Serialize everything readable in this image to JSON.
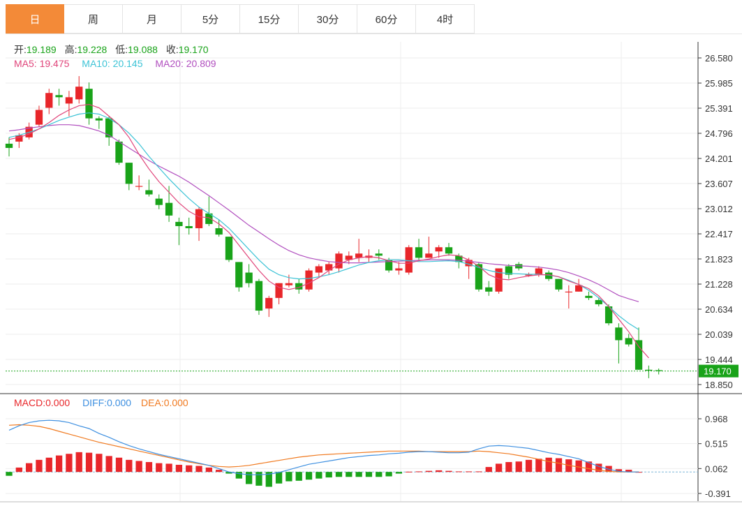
{
  "tabs": [
    {
      "label": "日",
      "active": true
    },
    {
      "label": "周",
      "active": false
    },
    {
      "label": "月",
      "active": false
    },
    {
      "label": "5分",
      "active": false
    },
    {
      "label": "15分",
      "active": false
    },
    {
      "label": "30分",
      "active": false
    },
    {
      "label": "60分",
      "active": false
    },
    {
      "label": "4时",
      "active": false
    }
  ],
  "ohlc_legend": {
    "open_label": "开:",
    "open": "19.189",
    "high_label": "高:",
    "high": "19.228",
    "low_label": "低:",
    "low": "19.088",
    "close_label": "收:",
    "close": "19.170"
  },
  "ma_legend": {
    "ma5_label": "MA5: ",
    "ma5": "19.475",
    "ma10_label": "MA10: ",
    "ma10": "20.145",
    "ma20_label": "MA20: ",
    "ma20": "20.809"
  },
  "macd_legend": {
    "macd_label": "MACD:",
    "macd": "0.000",
    "diff_label": "DIFF:",
    "diff": "0.000",
    "dea_label": "DEA:",
    "dea": "0.000"
  },
  "colors": {
    "up": "#e8262a",
    "down": "#19a319",
    "ma5": "#e0447a",
    "ma10": "#3cc3d6",
    "ma20": "#b14fbf",
    "diff": "#3d8fe0",
    "dea": "#f07a20",
    "active_tab": "#f38a38",
    "last_price": "#19a319"
  },
  "chart_data": [
    {
      "type": "candlestick",
      "y_ticks": [
        "26.580",
        "25.985",
        "25.391",
        "24.796",
        "24.201",
        "23.607",
        "23.012",
        "22.417",
        "21.823",
        "21.228",
        "20.634",
        "20.039",
        "19.444",
        "18.850"
      ],
      "ylim": [
        18.85,
        26.58
      ],
      "last_price": "19.170",
      "candles": [
        [
          24.55,
          24.7,
          24.25,
          24.45
        ],
        [
          24.6,
          24.8,
          24.45,
          24.75
        ],
        [
          24.7,
          25.05,
          24.65,
          24.95
        ],
        [
          25.0,
          25.45,
          24.95,
          25.35
        ],
        [
          25.4,
          25.85,
          25.25,
          25.75
        ],
        [
          25.7,
          25.85,
          25.45,
          25.65
        ],
        [
          25.5,
          25.8,
          25.2,
          25.65
        ],
        [
          25.6,
          26.15,
          25.5,
          25.9
        ],
        [
          25.85,
          26.0,
          25.0,
          25.15
        ],
        [
          25.15,
          25.2,
          24.9,
          25.1
        ],
        [
          25.15,
          25.2,
          24.5,
          24.7
        ],
        [
          24.6,
          24.65,
          24.05,
          24.1
        ],
        [
          24.1,
          24.1,
          23.45,
          23.6
        ],
        [
          23.55,
          23.8,
          23.45,
          23.55
        ],
        [
          23.45,
          23.7,
          23.3,
          23.35
        ],
        [
          23.25,
          23.35,
          23.0,
          23.1
        ],
        [
          23.15,
          23.55,
          22.7,
          22.85
        ],
        [
          22.7,
          22.8,
          22.15,
          22.6
        ],
        [
          22.6,
          22.8,
          22.4,
          22.55
        ],
        [
          22.55,
          23.05,
          22.25,
          23.0
        ],
        [
          22.9,
          23.3,
          22.6,
          22.65
        ],
        [
          22.55,
          22.75,
          22.35,
          22.4
        ],
        [
          22.35,
          22.35,
          21.75,
          21.8
        ],
        [
          21.75,
          21.75,
          21.05,
          21.15
        ],
        [
          21.5,
          21.7,
          21.15,
          21.25
        ],
        [
          21.3,
          21.35,
          20.5,
          20.6
        ],
        [
          20.65,
          20.95,
          20.45,
          20.9
        ],
        [
          20.9,
          21.25,
          20.75,
          21.25
        ],
        [
          21.2,
          21.45,
          21.15,
          21.25
        ],
        [
          21.25,
          21.35,
          21.0,
          21.1
        ],
        [
          21.1,
          21.6,
          21.05,
          21.55
        ],
        [
          21.5,
          21.7,
          21.4,
          21.65
        ],
        [
          21.55,
          21.75,
          21.45,
          21.7
        ],
        [
          21.6,
          22.0,
          21.5,
          21.95
        ],
        [
          21.8,
          22.0,
          21.7,
          21.9
        ],
        [
          21.85,
          22.3,
          21.75,
          21.95
        ],
        [
          21.85,
          22.05,
          21.75,
          21.9
        ],
        [
          21.95,
          22.05,
          21.8,
          21.9
        ],
        [
          21.8,
          21.85,
          21.5,
          21.55
        ],
        [
          21.55,
          21.75,
          21.45,
          21.6
        ],
        [
          21.5,
          22.15,
          21.45,
          22.1
        ],
        [
          22.1,
          22.3,
          21.8,
          21.85
        ],
        [
          21.85,
          22.35,
          21.85,
          21.95
        ],
        [
          22.0,
          22.15,
          21.85,
          22.1
        ],
        [
          22.1,
          22.2,
          21.9,
          21.95
        ],
        [
          21.9,
          21.95,
          21.6,
          21.75
        ],
        [
          21.65,
          21.85,
          21.35,
          21.8
        ],
        [
          21.7,
          21.75,
          21.05,
          21.1
        ],
        [
          21.15,
          21.3,
          20.95,
          21.05
        ],
        [
          21.05,
          21.6,
          21.0,
          21.6
        ],
        [
          21.65,
          21.7,
          21.35,
          21.45
        ],
        [
          21.7,
          21.75,
          21.55,
          21.6
        ],
        [
          21.45,
          21.5,
          21.4,
          21.45
        ],
        [
          21.45,
          21.65,
          21.4,
          21.6
        ],
        [
          21.5,
          21.55,
          21.3,
          21.35
        ],
        [
          21.35,
          21.35,
          21.05,
          21.1
        ],
        [
          21.05,
          21.2,
          20.65,
          21.05
        ],
        [
          21.05,
          21.35,
          21.05,
          21.2
        ],
        [
          20.95,
          21.05,
          20.85,
          20.9
        ],
        [
          20.85,
          20.9,
          20.7,
          20.75
        ],
        [
          20.7,
          20.75,
          20.25,
          20.3
        ],
        [
          20.2,
          20.3,
          19.35,
          19.9
        ],
        [
          19.95,
          20.05,
          19.75,
          19.8
        ],
        [
          19.9,
          20.2,
          19.2,
          19.2
        ],
        [
          19.2,
          19.3,
          19.0,
          19.18
        ],
        [
          19.19,
          19.23,
          19.09,
          19.17
        ]
      ],
      "ma5": [
        24.65,
        24.7,
        24.78,
        24.9,
        25.05,
        25.22,
        25.35,
        25.45,
        25.48,
        25.4,
        25.2,
        25.0,
        24.7,
        24.3,
        23.95,
        23.65,
        23.4,
        23.15,
        22.95,
        22.82,
        22.8,
        22.65,
        22.45,
        22.15,
        21.85,
        21.55,
        21.3,
        21.15,
        21.1,
        21.15,
        21.25,
        21.38,
        21.55,
        21.7,
        21.8,
        21.85,
        21.88,
        21.85,
        21.78,
        21.72,
        21.72,
        21.78,
        21.82,
        21.88,
        21.92,
        21.9,
        21.8,
        21.65,
        21.45,
        21.35,
        21.33,
        21.38,
        21.42,
        21.45,
        21.45,
        21.4,
        21.3,
        21.22,
        21.12,
        20.95,
        20.7,
        20.4,
        20.1,
        19.75,
        19.48
      ],
      "ma10": [
        24.7,
        24.75,
        24.82,
        24.9,
        25.0,
        25.1,
        25.18,
        25.25,
        25.28,
        25.25,
        25.15,
        25.0,
        24.8,
        24.55,
        24.25,
        23.98,
        23.72,
        23.48,
        23.25,
        23.05,
        22.9,
        22.75,
        22.55,
        22.3,
        22.05,
        21.8,
        21.58,
        21.45,
        21.38,
        21.35,
        21.36,
        21.4,
        21.45,
        21.52,
        21.6,
        21.68,
        21.74,
        21.78,
        21.8,
        21.8,
        21.78,
        21.76,
        21.76,
        21.77,
        21.78,
        21.76,
        21.7,
        21.62,
        21.55,
        21.5,
        21.48,
        21.47,
        21.46,
        21.46,
        21.44,
        21.4,
        21.32,
        21.22,
        21.08,
        20.9,
        20.7,
        20.48,
        20.3,
        20.15
      ],
      "ma20": [
        24.85,
        24.88,
        24.92,
        24.95,
        24.98,
        25.0,
        25.0,
        24.98,
        24.92,
        24.85,
        24.75,
        24.6,
        24.45,
        24.3,
        24.15,
        24.02,
        23.9,
        23.78,
        23.64,
        23.48,
        23.32,
        23.15,
        22.98,
        22.8,
        22.62,
        22.46,
        22.3,
        22.15,
        22.02,
        21.92,
        21.85,
        21.8,
        21.76,
        21.74,
        21.73,
        21.73,
        21.74,
        21.75,
        21.76,
        21.77,
        21.78,
        21.79,
        21.8,
        21.8,
        21.8,
        21.79,
        21.77,
        21.74,
        21.71,
        21.69,
        21.67,
        21.66,
        21.65,
        21.63,
        21.6,
        21.56,
        21.5,
        21.42,
        21.33,
        21.22,
        21.09,
        20.96,
        20.88,
        20.81
      ],
      "ma_start_index": [
        0,
        0,
        0
      ]
    },
    {
      "type": "macd",
      "y_ticks": [
        "0.968",
        "0.515",
        "0.062",
        "-0.391"
      ],
      "ylim": [
        -0.391,
        0.968
      ],
      "hist": [
        -0.07,
        0.08,
        0.16,
        0.22,
        0.26,
        0.3,
        0.33,
        0.36,
        0.35,
        0.33,
        0.29,
        0.26,
        0.22,
        0.2,
        0.18,
        0.16,
        0.15,
        0.13,
        0.12,
        0.11,
        0.08,
        0.04,
        -0.03,
        -0.12,
        -0.22,
        -0.25,
        -0.27,
        -0.21,
        -0.17,
        -0.16,
        -0.14,
        -0.12,
        -0.1,
        -0.09,
        -0.09,
        -0.09,
        -0.09,
        -0.09,
        -0.08,
        -0.03,
        0.005,
        0.01,
        0.02,
        0.03,
        0.02,
        0.01,
        0.01,
        0.01,
        0.09,
        0.15,
        0.18,
        0.19,
        0.22,
        0.24,
        0.26,
        0.25,
        0.23,
        0.21,
        0.19,
        0.15,
        0.11,
        0.05,
        0.04,
        0.0
      ],
      "diff": [
        0.76,
        0.84,
        0.9,
        0.93,
        0.94,
        0.93,
        0.9,
        0.84,
        0.79,
        0.7,
        0.63,
        0.55,
        0.48,
        0.42,
        0.37,
        0.32,
        0.28,
        0.24,
        0.2,
        0.16,
        0.12,
        0.06,
        0.0,
        -0.03,
        -0.05,
        -0.05,
        -0.04,
        -0.01,
        0.04,
        0.09,
        0.14,
        0.17,
        0.2,
        0.23,
        0.26,
        0.28,
        0.3,
        0.31,
        0.33,
        0.34,
        0.36,
        0.37,
        0.37,
        0.36,
        0.35,
        0.35,
        0.36,
        0.42,
        0.47,
        0.48,
        0.47,
        0.45,
        0.43,
        0.39,
        0.35,
        0.32,
        0.28,
        0.24,
        0.17,
        0.1,
        0.05,
        0.01,
        0.0,
        0.0
      ],
      "dea": [
        0.85,
        0.86,
        0.85,
        0.83,
        0.79,
        0.74,
        0.69,
        0.64,
        0.59,
        0.54,
        0.5,
        0.46,
        0.42,
        0.38,
        0.34,
        0.3,
        0.26,
        0.22,
        0.18,
        0.15,
        0.12,
        0.1,
        0.09,
        0.1,
        0.12,
        0.15,
        0.18,
        0.21,
        0.24,
        0.27,
        0.29,
        0.31,
        0.32,
        0.33,
        0.34,
        0.35,
        0.36,
        0.37,
        0.38,
        0.38,
        0.38,
        0.38,
        0.37,
        0.37,
        0.37,
        0.37,
        0.37,
        0.38,
        0.37,
        0.35,
        0.33,
        0.3,
        0.27,
        0.23,
        0.19,
        0.16,
        0.12,
        0.09,
        0.06,
        0.03,
        0.01,
        0.0,
        0.0,
        0.0
      ]
    }
  ]
}
